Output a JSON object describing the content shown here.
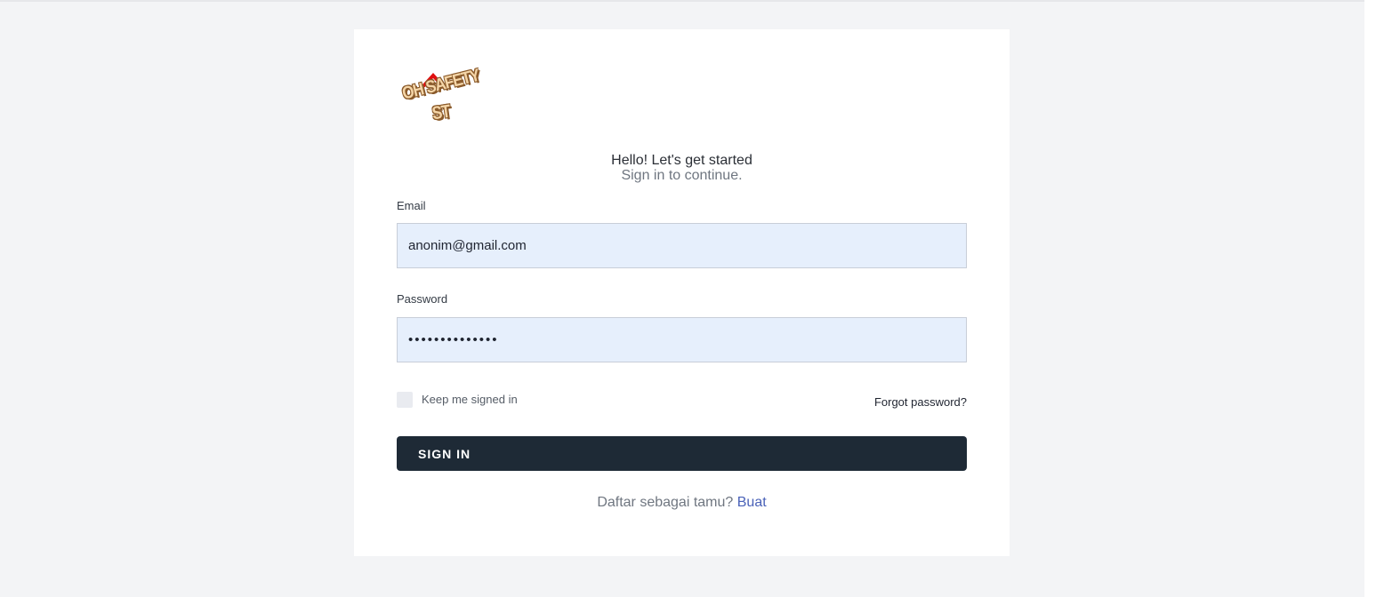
{
  "logo": {
    "line1": "OH SAFETY",
    "line2": "ST"
  },
  "header": {
    "title": "Hello! Let's get started",
    "subtitle": "Sign in to continue."
  },
  "form": {
    "email_label": "Email",
    "email_value": "anonim@gmail.com",
    "password_label": "Password",
    "password_value": "••••••••••••••",
    "keep_signed_in_label": "Keep me signed in",
    "keep_signed_in_checked": false,
    "forgot_password_label": "Forgot password?",
    "submit_label": "SIGN IN"
  },
  "footer": {
    "prompt": "Daftar sebagai tamu?",
    "link_label": "Buat"
  },
  "colors": {
    "background": "#f3f4f6",
    "card": "#ffffff",
    "input_bg": "#e6effc",
    "button_bg": "#1e2a36",
    "link": "#4a62b8",
    "logo_roof": "#e01010"
  }
}
